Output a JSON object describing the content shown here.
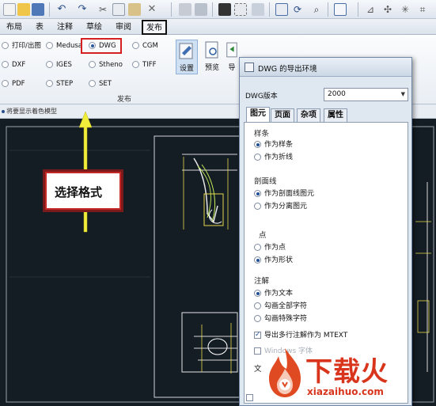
{
  "ribbon_tabs": [
    "布局",
    "表",
    "注释",
    "草绘",
    "审阅",
    "发布"
  ],
  "export_formats": [
    {
      "label": "打印/出图",
      "selected": false
    },
    {
      "label": "Medusa",
      "selected": false
    },
    {
      "label": "DWG",
      "selected": true
    },
    {
      "label": "CGM",
      "selected": false
    },
    {
      "label": "DXF",
      "selected": false
    },
    {
      "label": "IGES",
      "selected": false
    },
    {
      "label": "Stheno",
      "selected": false
    },
    {
      "label": "TIFF",
      "selected": false
    },
    {
      "label": "PDF",
      "selected": false
    },
    {
      "label": "STEP",
      "selected": false
    },
    {
      "label": "SET",
      "selected": false
    }
  ],
  "publish_group_label": "发布",
  "big_buttons": {
    "settings": "设置",
    "preview": "预览",
    "export": "导"
  },
  "status_hint": "将要显示着色模型",
  "callout_text": "选择格式",
  "dialog": {
    "title": "DWG 的导出环境",
    "version_label": "DWG版本",
    "version_value": "2000",
    "tabs": [
      "图元",
      "页面",
      "杂项",
      "属性"
    ],
    "sections": {
      "spline": {
        "title": "样条",
        "options": [
          "作为样条",
          "作为折线"
        ],
        "selected": 0
      },
      "hatch": {
        "title": "剖面线",
        "options": [
          "作为剖面线图元",
          "作为分离图元"
        ],
        "selected": 0
      },
      "point": {
        "title": "点",
        "options": [
          "作为点",
          "作为形状"
        ],
        "selected": 1
      },
      "note": {
        "title": "注解",
        "options": [
          "作为文本",
          "勾画全部字符",
          "勾画特殊字符"
        ],
        "selected": 0
      }
    },
    "mtext_checkbox": "导出多行注解作为 MTEXT",
    "dim_checkbox": "Windows 字体",
    "bottom_text": "文"
  },
  "watermark": {
    "brand": "下载火",
    "url": "xiazaihuo.com"
  },
  "colors": {
    "highlight_red": "#d42020",
    "arrow_yellow": "#f0ee3a",
    "canvas_bg": "#141c24",
    "watermark": "#d8351c"
  }
}
